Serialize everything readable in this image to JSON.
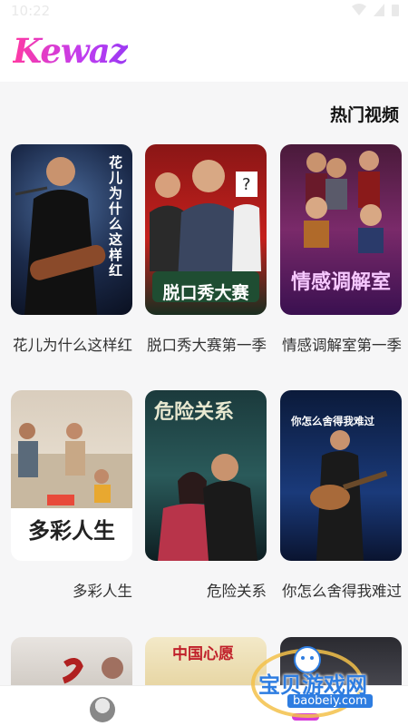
{
  "status": {
    "time": "10:22"
  },
  "app": {
    "logo": "Kewaz"
  },
  "section": {
    "title": "热门视频"
  },
  "videos": [
    {
      "title": "花儿为什么这样红",
      "overlay": "花儿为什么这样红"
    },
    {
      "title": "脱口秀大赛第一季",
      "overlay": "脱口秀大赛"
    },
    {
      "title": "情感调解室第一季",
      "overlay": "情感调解室"
    },
    {
      "title": "多彩人生",
      "overlay": "多彩人生"
    },
    {
      "title": "危险关系",
      "overlay": "危险关系"
    },
    {
      "title": "你怎么舍得我难过",
      "overlay": "你怎么舍得我难过"
    },
    {
      "title": "",
      "overlay": ""
    },
    {
      "title": "",
      "overlay": "中国心愿"
    },
    {
      "title": "",
      "overlay": ""
    }
  ],
  "watermark": {
    "text": "宝贝游戏网",
    "url": "baobeiy.com"
  }
}
